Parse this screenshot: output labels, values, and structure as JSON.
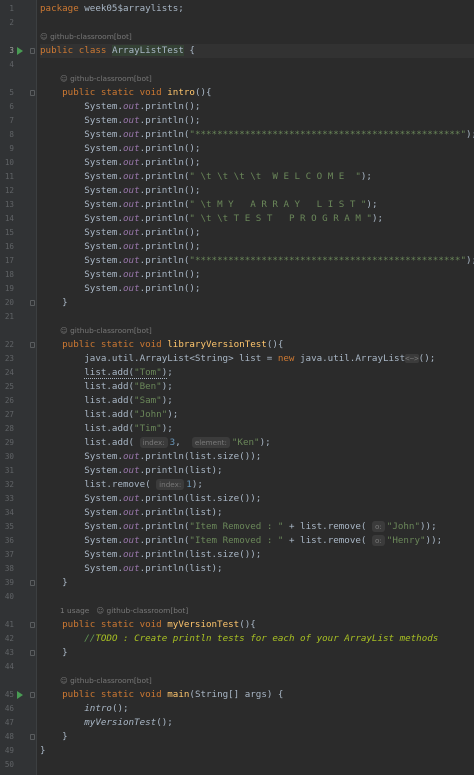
{
  "code": {
    "package_kw": "package",
    "package_name": "week05$arraylists;",
    "public_kw": "public",
    "class_kw": "class",
    "static_kw": "static",
    "void_kw": "void",
    "new_kw": "new",
    "class_name": "ArrayListTest",
    "author_hint": "github-classroom[bot]",
    "usage_hint": "1 usage",
    "intro_name": "intro",
    "library_name": "libraryVersionTest",
    "my_version_name": "myVersionTest",
    "main_name": "main",
    "main_params": "(String[] args) {",
    "sysout_prefix": "System.",
    "sysout_out": "out",
    "println_empty": ".println();",
    "println_open": ".println(",
    "stars": "\"************************************************\"",
    "welcome": "\" \\t \\t \\t \\t  W E L C O M E  \"",
    "my_array_list": "\" \\t M Y   A R R A Y   L I S T \"",
    "test_program": "\" \\t \\t T E S T   P R O G R A M \"",
    "list_decl_a": "java.util.ArrayList<String> list = ",
    "list_decl_b": " java.util.ArrayList",
    "diamond_fold": "<~>",
    "list_add_open": "list.add(",
    "names": [
      "\"Tom\"",
      "\"Ben\"",
      "\"Sam\"",
      "\"John\"",
      "\"Tim\""
    ],
    "index_hint": "index:",
    "element_hint": "element:",
    "o_hint": "o:",
    "three": "3",
    "one": "1",
    "ken": "\"Ken\"",
    "list_size": "list.size());",
    "list_plain": "list);",
    "list_remove_open": "list.remove(",
    "item_removed": "\"Item Removed : \"",
    "plus_remove": " + list.remove(",
    "john": "\"John\"",
    "henry": "\"Henry\"",
    "todo_comment": "//TODO : Create println tests for each of your ArrayList methods",
    "intro_call": "intro",
    "my_version_call": "myVersionTest"
  },
  "gutter": {
    "line_numbers": [
      "1",
      "2",
      "3",
      "4",
      "5",
      "6",
      "7",
      "8",
      "9",
      "10",
      "11",
      "12",
      "13",
      "14",
      "15",
      "16",
      "17",
      "18",
      "19",
      "20",
      "21",
      "22",
      "23",
      "24",
      "25",
      "26",
      "27",
      "28",
      "29",
      "30",
      "31",
      "32",
      "33",
      "34",
      "35",
      "36",
      "37",
      "38",
      "39",
      "40",
      "41",
      "42",
      "43",
      "44",
      "45",
      "46",
      "47",
      "48",
      "49",
      "50"
    ]
  }
}
